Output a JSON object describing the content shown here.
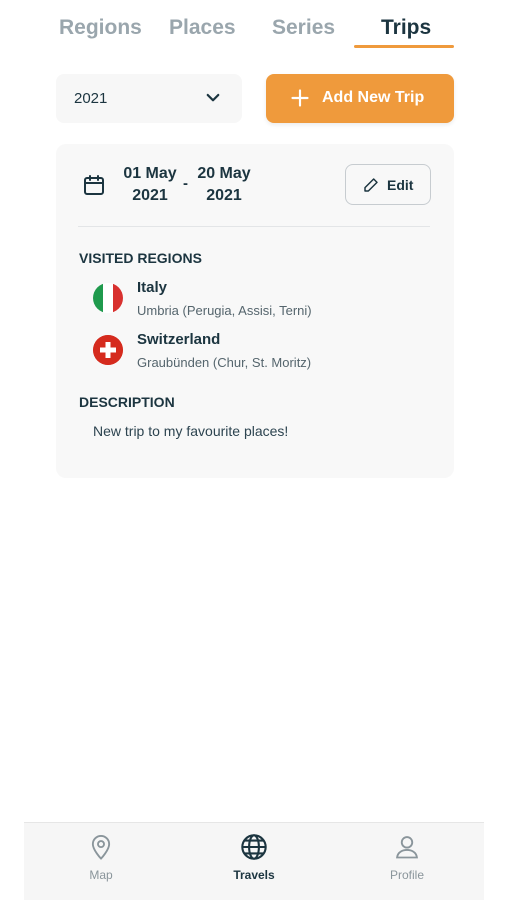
{
  "tabs": [
    {
      "label": "Regions"
    },
    {
      "label": "Places"
    },
    {
      "label": "Series"
    },
    {
      "label": "Trips",
      "active": true
    }
  ],
  "filter": {
    "year_value": "2021",
    "icon": "chevron-down-icon"
  },
  "add_button": {
    "label": "Add New Trip",
    "icon": "plus-icon"
  },
  "trip": {
    "date_from": {
      "line1": "01 May",
      "line2": "2021"
    },
    "date_separator": "-",
    "date_to": {
      "line1": "20 May",
      "line2": "2021"
    },
    "edit_label": "Edit",
    "visited_regions_heading": "VISITED REGIONS",
    "regions": [
      {
        "name": "Italy",
        "detail": "Umbria (Perugia, Assisi, Terni)",
        "flag": "italy-flag-icon"
      },
      {
        "name": "Switzerland",
        "detail": "Graubünden (Chur, St. Moritz)",
        "flag": "switzerland-flag-icon"
      }
    ],
    "description_heading": "DESCRIPTION",
    "description": "New trip to my favourite places!"
  },
  "bottom_nav": [
    {
      "label": "Map",
      "icon": "map-pin-icon"
    },
    {
      "label": "Travels",
      "icon": "globe-icon",
      "active": true
    },
    {
      "label": "Profile",
      "icon": "user-icon"
    }
  ],
  "colors": {
    "accent": "#ef9a3c",
    "text_dark": "#1c3540",
    "tab_inactive": "#9aa6ad",
    "card_bg": "#f8f8f8"
  }
}
